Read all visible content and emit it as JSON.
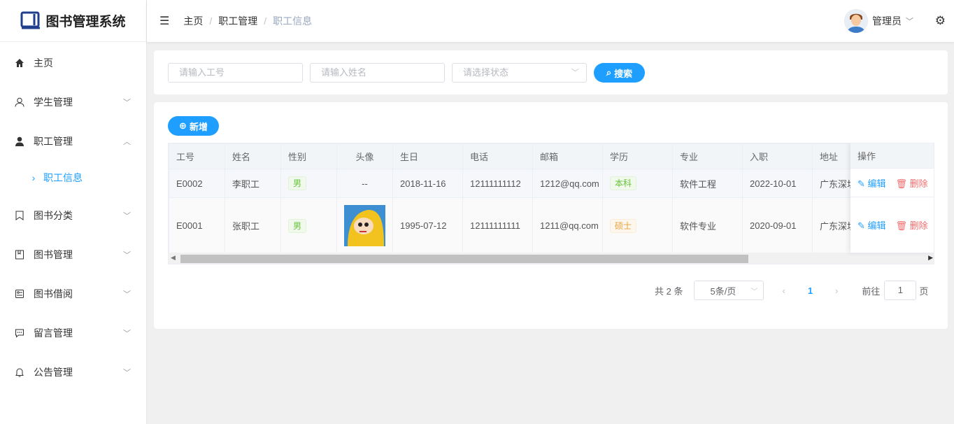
{
  "app": {
    "title": "图书管理系统"
  },
  "sidebar": {
    "items": [
      {
        "label": "主页",
        "icon": "home-icon"
      },
      {
        "label": "学生管理",
        "icon": "user-icon"
      },
      {
        "label": "职工管理",
        "icon": "user-filled-icon"
      },
      {
        "label": "职工信息",
        "icon": "chevron-right-icon"
      },
      {
        "label": "图书分类",
        "icon": "bookmark-icon"
      },
      {
        "label": "图书管理",
        "icon": "book-icon"
      },
      {
        "label": "图书借阅",
        "icon": "tickets-icon"
      },
      {
        "label": "留言管理",
        "icon": "chat-icon"
      },
      {
        "label": "公告管理",
        "icon": "bell-icon"
      }
    ]
  },
  "header": {
    "breadcrumb": [
      "主页",
      "职工管理",
      "职工信息"
    ],
    "user": "管理员"
  },
  "search": {
    "id_placeholder": "请输入工号",
    "name_placeholder": "请输入姓名",
    "status_placeholder": "请选择状态",
    "search_label": "搜索"
  },
  "toolbar": {
    "add_label": "新增"
  },
  "table": {
    "headers": [
      "工号",
      "姓名",
      "性别",
      "头像",
      "生日",
      "电话",
      "邮箱",
      "学历",
      "专业",
      "入职",
      "地址",
      "操作"
    ],
    "rows": [
      {
        "id": "E0002",
        "name": "李职工",
        "gender": "男",
        "avatar": "--",
        "birthday": "2018-11-16",
        "phone": "12111111112",
        "email": "1212@qq.com",
        "education": "本科",
        "major": "软件工程",
        "hired": "2022-10-01",
        "address": "广东深圳"
      },
      {
        "id": "E0001",
        "name": "张职工",
        "gender": "男",
        "avatar": "",
        "birthday": "1995-07-12",
        "phone": "12111111111",
        "email": "1211@qq.com",
        "education": "硕士",
        "major": "软件专业",
        "hired": "2020-09-01",
        "address": "广东深圳"
      }
    ],
    "edit_label": "编辑",
    "delete_label": "删除"
  },
  "pagination": {
    "total": "共 2 条",
    "page_size": "5条/页",
    "current": "1",
    "goto_label": "前往",
    "goto_value": "1",
    "page_suffix": "页"
  },
  "colors": {
    "accent": "#1e9fff",
    "danger": "#f56c6c"
  }
}
